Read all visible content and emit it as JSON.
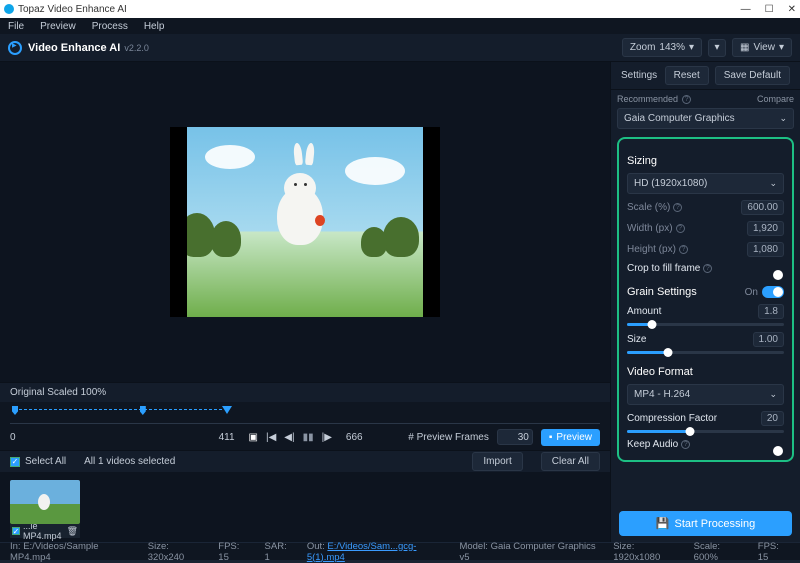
{
  "titlebar": {
    "title": "Topaz Video Enhance AI"
  },
  "menubar": [
    "File",
    "Preview",
    "Process",
    "Help"
  ],
  "header": {
    "appname": "Video Enhance AI",
    "version": "v2.2.0",
    "zoom_label": "Zoom",
    "zoom_value": "143%",
    "view_label": "View"
  },
  "right_header": {
    "settings": "Settings",
    "reset": "Reset",
    "save_default": "Save Default"
  },
  "settings_panel": {
    "recommended": "Recommended",
    "compare": "Compare",
    "model_select": "Gaia Computer Graphics",
    "sizing": {
      "title": "Sizing",
      "preset": "HD (1920x1080)",
      "fields": {
        "scale_label": "Scale (%)",
        "scale_val": "600.00",
        "width_label": "Width (px)",
        "width_val": "1,920",
        "height_label": "Height (px)",
        "height_val": "1,080",
        "crop_label": "Crop to fill frame"
      }
    },
    "grain": {
      "title": "Grain Settings",
      "state": "On",
      "amount_label": "Amount",
      "amount_val": "1.8",
      "amount_pct": 16,
      "size_label": "Size",
      "size_val": "1.00",
      "size_pct": 26
    },
    "format": {
      "title": "Video Format",
      "preset": "MP4 - H.264",
      "comp_label": "Compression Factor",
      "comp_val": "20",
      "comp_pct": 40,
      "keep_audio": "Keep Audio"
    }
  },
  "start_button": "Start Processing",
  "preview_area": {
    "scale_label": "Original Scaled 100%",
    "timeline": {
      "start": "0",
      "current": "411",
      "end": "666",
      "frames_label": "# Preview Frames",
      "frames_val": "30",
      "preview_btn": "Preview"
    }
  },
  "file_row": {
    "select_all": "Select All",
    "count_text": "All 1 videos selected",
    "import": "Import",
    "clear": "Clear All"
  },
  "thumb": {
    "name": "...le MP4.mp4"
  },
  "status": {
    "in_label": "In:",
    "in_path": "E:/Videos/Sample MP4.mp4",
    "size_label": "Size:",
    "size_val": "320x240",
    "fps_label": "FPS:",
    "fps_val": "15",
    "sar_label": "SAR:",
    "sar_val": "1",
    "out_label": "Out:",
    "out_path": "E:/Videos/Sam...gcg-5(1).mp4",
    "model_label": "Model:",
    "model_val": "Gaia Computer Graphics v5",
    "size2": "1920x1080",
    "scale_label": "Scale:",
    "scale_val": "600%",
    "fps2": "15"
  }
}
